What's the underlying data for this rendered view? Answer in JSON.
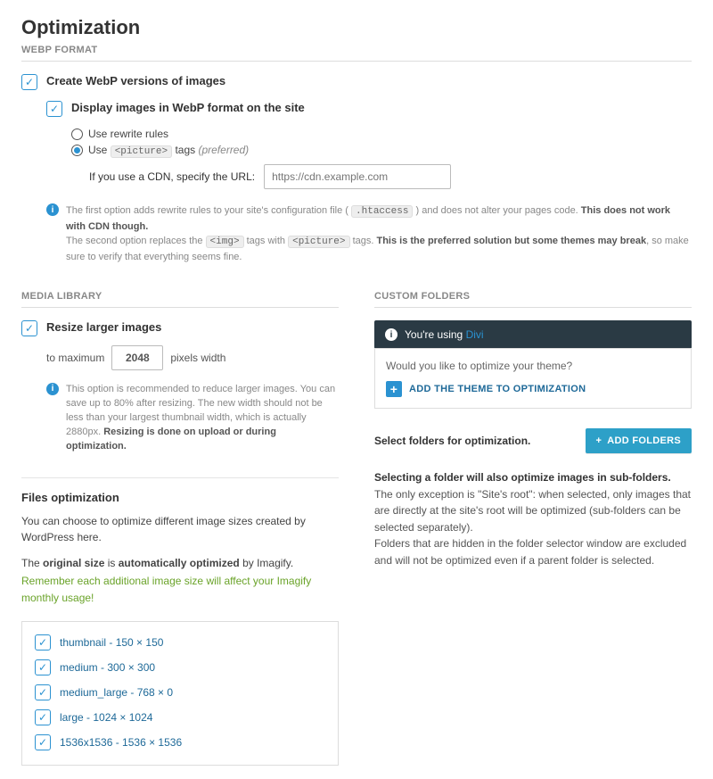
{
  "page": {
    "title": "Optimization"
  },
  "webp": {
    "heading": "WEBP FORMAT",
    "create_label": "Create WebP versions of images",
    "display_label": "Display images in WebP format on the site",
    "radio_rewrite": "Use rewrite rules",
    "radio_picture_prefix": "Use ",
    "radio_picture_code": "<picture>",
    "radio_picture_suffix": " tags ",
    "radio_picture_preferred": "(preferred)",
    "cdn_label": "If you use a CDN, specify the URL:",
    "cdn_placeholder": "https://cdn.example.com",
    "note_line1a": "The first option adds rewrite rules to your site's configuration file ( ",
    "note_htaccess": ".htaccess",
    "note_line1b": " ) and does not alter your pages code. ",
    "note_line1c": "This does not work with CDN though.",
    "note_line2a": "The second option replaces the ",
    "note_img": "<img>",
    "note_line2b": " tags with ",
    "note_pic": "<picture>",
    "note_line2c": " tags. ",
    "note_line2d": "This is the preferred solution but some themes may break",
    "note_line2e": ", so make sure to verify that everything seems fine."
  },
  "media": {
    "heading": "MEDIA LIBRARY",
    "resize_label": "Resize larger images",
    "to_max": "to maximum",
    "max_value": "2048",
    "px_label": "pixels width",
    "note_a": "This option is recommended to reduce larger images. You can save up to 80% after resizing. The new width should not be less than your largest thumbnail width, which is actually 2880px. ",
    "note_b": "Resizing is done on upload or during optimization.",
    "files_heading": "Files optimization",
    "files_p1": "You can choose to optimize different image sizes created by WordPress here.",
    "files_p2a": "The ",
    "files_p2b": "original size",
    "files_p2c": " is ",
    "files_p2d": "automatically optimized",
    "files_p2e": " by Imagify.",
    "files_p3": "Remember each additional image size will affect your Imagify monthly usage!",
    "sizes": [
      "thumbnail - 150 × 150",
      "medium - 300 × 300",
      "medium_large - 768 × 0",
      "large - 1024 × 1024",
      "1536x1536 - 1536 × 1536"
    ]
  },
  "custom": {
    "heading": "CUSTOM FOLDERS",
    "banner_a": "You're using ",
    "banner_theme": "Divi",
    "panel_q": "Would you like to optimize your theme?",
    "add_theme": "ADD THE THEME TO OPTIMIZATION",
    "select_label": "Select folders for optimization.",
    "add_folders": "ADD FOLDERS",
    "folder_b": "Selecting a folder will also optimize images in sub-folders.",
    "folder_rest": " The only exception is \"Site's root\": when selected, only images that are directly at the site's root will be optimized (sub-folders can be selected separately).\nFolders that are hidden in the folder selector window are excluded and will not be optimized even if a parent folder is selected."
  }
}
